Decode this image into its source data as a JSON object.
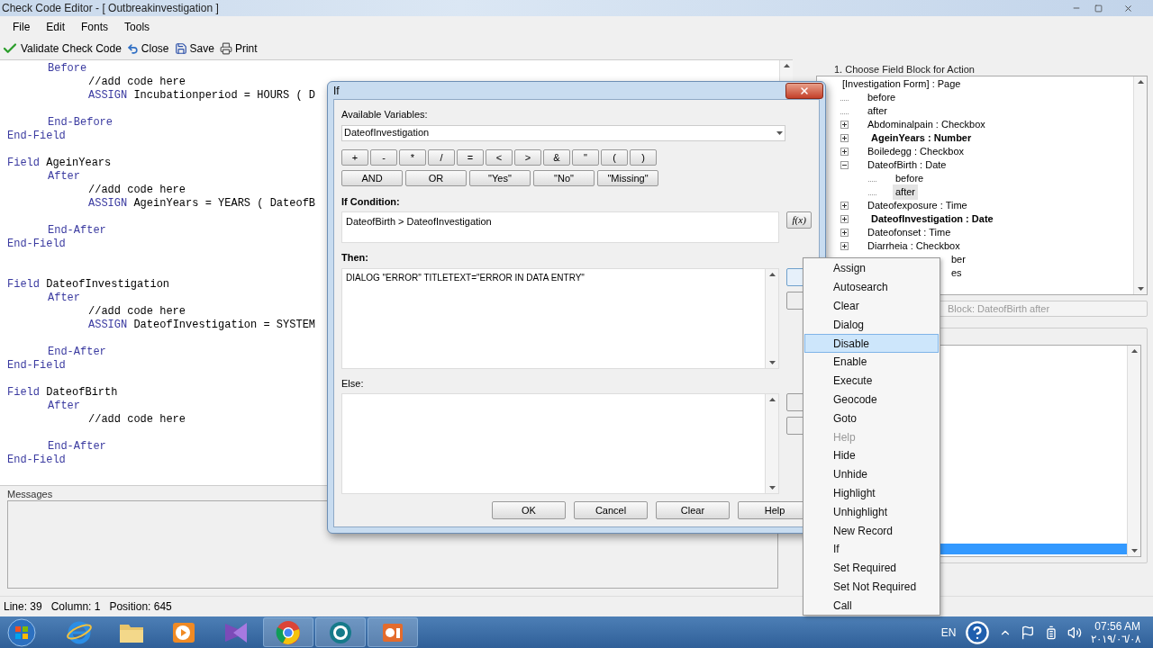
{
  "window": {
    "title": "Check Code Editor - [ Outbreakinvestigation ]"
  },
  "menu": [
    "File",
    "Edit",
    "Fonts",
    "Tools"
  ],
  "toolbar": [
    {
      "kind": "validate",
      "label": "Validate Check Code"
    },
    {
      "kind": "close",
      "label": "Close"
    },
    {
      "kind": "save",
      "label": "Save"
    },
    {
      "kind": "print",
      "label": "Print"
    }
  ],
  "code": [
    {
      "kind": "group",
      "children": [
        {
          "kind": "line",
          "keyword": "Before",
          "children": [
            {
              "kind": "line",
              "rest": "//add code here"
            },
            {
              "kind": "line",
              "keyword": "ASSIGN",
              "rest": "Incubationperiod = HOURS ( D"
            },
            {
              "kind": "blank"
            }
          ]
        },
        {
          "kind": "line",
          "keyword": "End-Before"
        }
      ]
    },
    {
      "kind": "line",
      "keyword": "End-Field"
    },
    {
      "kind": "blank"
    },
    {
      "kind": "line",
      "keyword": "Field",
      "rest": "AgeinYears",
      "children": [
        {
          "kind": "line",
          "keyword": "After",
          "children": [
            {
              "kind": "line",
              "rest": "//add code here"
            },
            {
              "kind": "line",
              "keyword": "ASSIGN",
              "rest": "AgeinYears = YEARS ( DateofB"
            },
            {
              "kind": "blank"
            }
          ]
        },
        {
          "kind": "line",
          "keyword": "End-After"
        }
      ]
    },
    {
      "kind": "line",
      "keyword": "End-Field"
    },
    {
      "kind": "blank"
    },
    {
      "kind": "blank"
    },
    {
      "kind": "line",
      "keyword": "Field",
      "rest": "DateofInvestigation",
      "children": [
        {
          "kind": "line",
          "keyword": "After",
          "children": [
            {
              "kind": "line",
              "rest": "//add code here"
            },
            {
              "kind": "line",
              "keyword": "ASSIGN",
              "rest": "DateofInvestigation = SYSTEM"
            },
            {
              "kind": "blank"
            }
          ]
        },
        {
          "kind": "line",
          "keyword": "End-After"
        }
      ]
    },
    {
      "kind": "line",
      "keyword": "End-Field"
    },
    {
      "kind": "blank"
    },
    {
      "kind": "line",
      "keyword": "Field",
      "rest": "DateofBirth",
      "children": [
        {
          "kind": "line",
          "keyword": "After",
          "children": [
            {
              "kind": "line",
              "rest": "//add code here"
            },
            {
              "kind": "blank"
            }
          ]
        },
        {
          "kind": "line",
          "keyword": "End-After"
        }
      ]
    },
    {
      "kind": "line",
      "keyword": "End-Field"
    }
  ],
  "messages": {
    "label": "Messages"
  },
  "status_bar": [
    "Line: 39",
    "Column: 1",
    "Position: 645"
  ],
  "field_block": {
    "label": "1. Choose Field Block for Action",
    "tree": {
      "label": "[Investigation Form] : Page",
      "selected": false,
      "children": [
        {
          "kind": "leaf",
          "label": "before",
          "selected": false
        },
        {
          "kind": "leaf",
          "label": "after",
          "selected": false
        },
        {
          "kind": "node",
          "label": "Abdominalpain : Checkbox",
          "bold": false,
          "expanded": false,
          "selected": false
        },
        {
          "kind": "node",
          "label": "AgeinYears : Number",
          "bold": true,
          "expanded": false,
          "selected": false
        },
        {
          "kind": "node",
          "label": "Boiledegg : Checkbox",
          "bold": false,
          "expanded": false,
          "selected": false
        },
        {
          "kind": "node",
          "label": "DateofBirth : Date",
          "bold": false,
          "expanded": true,
          "selected": false,
          "children": [
            {
              "kind": "leaf",
              "label": "before",
              "selected": false
            },
            {
              "kind": "leaf",
              "label": "after",
              "selected": true
            }
          ]
        },
        {
          "kind": "node",
          "label": "Dateofexposure : Time",
          "bold": false,
          "expanded": false,
          "selected": false
        },
        {
          "kind": "node",
          "label": "DateofInvestigation : Date",
          "bold": true,
          "expanded": false,
          "selected": false
        },
        {
          "kind": "node",
          "label": "Dateofonset : Time",
          "bold": false,
          "expanded": false,
          "selected": false
        },
        {
          "kind": "node",
          "label": "Diarrheia : Checkbox",
          "bold": false,
          "expanded": false,
          "selected": false
        },
        {
          "kind": "partial",
          "label": "ber",
          "selected": false
        },
        {
          "kind": "partial",
          "label": "es",
          "selected": false
        }
      ]
    },
    "block_field": "Block: DateofBirth after"
  },
  "actions_list": {
    "rows": [
      {
        "selected": true
      }
    ]
  },
  "dialog": {
    "title": "If",
    "variables_label": "Available Variables:",
    "variable": "DateofInvestigation",
    "operators": [
      "+",
      "-",
      "*",
      "/",
      "=",
      "<",
      ">",
      "&",
      "\"",
      "(",
      ")"
    ],
    "keywords": [
      "AND",
      "OR",
      "\"Yes\"",
      "\"No\"",
      "\"Missing\""
    ],
    "condition_label": "If Condition:",
    "condition": "DateofBirth > DateofInvestigation",
    "fx": "f(x)",
    "then_label": "Then:",
    "then": "DIALOG \"ERROR\" TITLETEXT=\"ERROR IN DATA ENTRY\"",
    "else_label": "Else:",
    "buttons": [
      "OK",
      "Cancel",
      "Clear",
      "Help"
    ]
  },
  "context_menu": [
    {
      "label": "Assign",
      "selected": false,
      "disabled": false
    },
    {
      "label": "Autosearch",
      "selected": false,
      "disabled": false
    },
    {
      "label": "Clear",
      "selected": false,
      "disabled": false
    },
    {
      "label": "Dialog",
      "selected": false,
      "disabled": false
    },
    {
      "label": "Disable",
      "selected": true,
      "disabled": false
    },
    {
      "label": "Enable",
      "selected": false,
      "disabled": false
    },
    {
      "label": "Execute",
      "selected": false,
      "disabled": false
    },
    {
      "label": "Geocode",
      "selected": false,
      "disabled": false
    },
    {
      "label": "Goto",
      "selected": false,
      "disabled": false
    },
    {
      "label": "Help",
      "selected": false,
      "disabled": true
    },
    {
      "label": "Hide",
      "selected": false,
      "disabled": false
    },
    {
      "label": "Unhide",
      "selected": false,
      "disabled": false
    },
    {
      "label": "Highlight",
      "selected": false,
      "disabled": false
    },
    {
      "label": "Unhighlight",
      "selected": false,
      "disabled": false
    },
    {
      "label": "New Record",
      "selected": false,
      "disabled": false
    },
    {
      "label": "If",
      "selected": false,
      "disabled": false
    },
    {
      "label": "Set Required",
      "selected": false,
      "disabled": false
    },
    {
      "label": "Set Not Required",
      "selected": false,
      "disabled": false
    },
    {
      "label": "Call",
      "selected": false,
      "disabled": false
    }
  ],
  "taskbar": {
    "apps": [
      {
        "kind": "browser-e",
        "active": false
      },
      {
        "kind": "folder",
        "active": false
      },
      {
        "kind": "media",
        "active": false
      },
      {
        "kind": "studio",
        "active": false
      },
      {
        "kind": "chrome",
        "active": true
      },
      {
        "kind": "ei",
        "active": true
      },
      {
        "kind": "office",
        "active": true
      }
    ],
    "language": "EN",
    "time": "07:56 AM",
    "date": "٢٠١٩/٠٦/٠٨"
  }
}
